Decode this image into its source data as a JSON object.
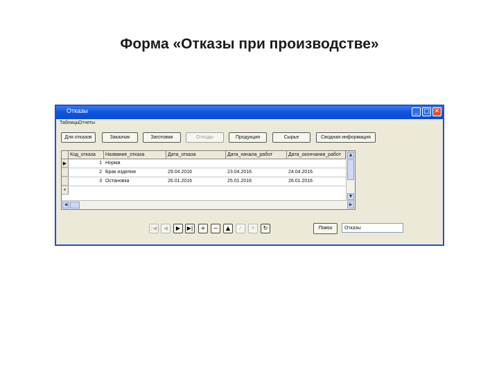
{
  "slide_title": "Форма «Отказы при производстве»",
  "window": {
    "title": "Отказы",
    "min_glyph": "_",
    "max_glyph": "□",
    "close_glyph": "✕"
  },
  "menu": [
    "Таблицы",
    "Отчеты"
  ],
  "toolbar": [
    "Для отказов",
    "Заказчик",
    "Заготовки",
    "Отходы",
    "Продукция",
    "Сырье",
    "Сводная информация"
  ],
  "table": {
    "columns": [
      "Код_отказа",
      "Название_отказа",
      "Дата_отказа",
      "Дата_начала_работ",
      "Дата_окончания_работ"
    ],
    "rows": [
      {
        "code": "1",
        "name": "Норма",
        "date": "",
        "start": "",
        "end": ""
      },
      {
        "code": "2",
        "name": "Брак изделия",
        "date": "29.04.2016",
        "start": "23.04.2016",
        "end": "24.04.2016"
      },
      {
        "code": "3",
        "name": "Остановка",
        "date": "26.01.2016",
        "start": "25.01.2016",
        "end": "26.01.2016"
      }
    ],
    "current_row_marker": "▶",
    "new_row_marker": "*"
  },
  "nav": {
    "first": "|◀",
    "prev": "◀",
    "next": "▶",
    "last": "▶|",
    "add": "+",
    "delete": "−",
    "edit": "▲",
    "save": "✓",
    "cancel": "✕",
    "refresh": "↻"
  },
  "search": {
    "button_label": "Поиск",
    "value": "Отказы"
  },
  "colors": {
    "titlebar": "#0d56e3",
    "window_bg": "#ece9d8"
  }
}
